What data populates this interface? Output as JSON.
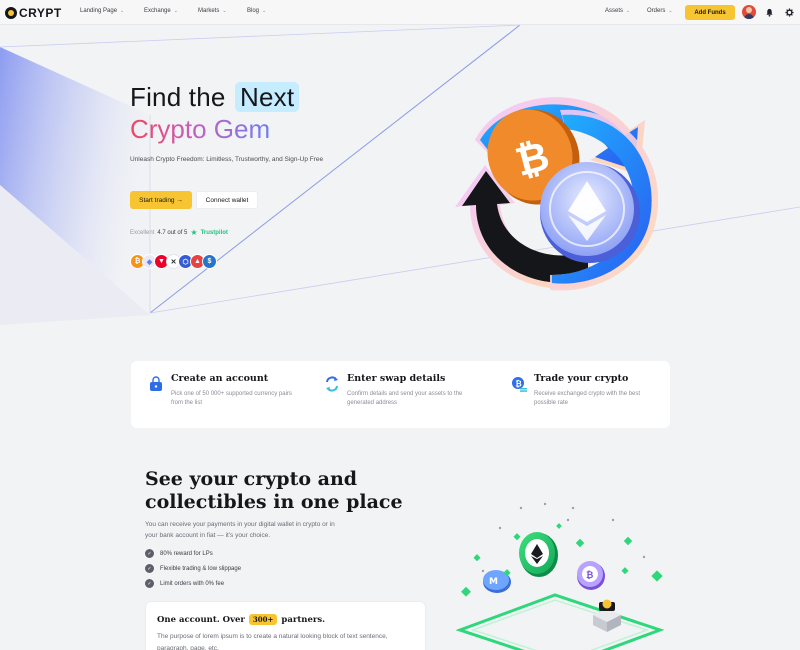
{
  "nav": {
    "logo_text": "CRYPT",
    "items": [
      {
        "label": "Landing Page"
      },
      {
        "label": "Exchange"
      },
      {
        "label": "Markets"
      },
      {
        "label": "Blog"
      }
    ],
    "right_items": [
      {
        "label": "Assets"
      },
      {
        "label": "Orders"
      }
    ],
    "add_funds_label": "Add Funds",
    "icons": [
      "bell-icon",
      "gear-icon"
    ]
  },
  "hero": {
    "title_line1": "Find the",
    "title_highlight": "Next",
    "title_line2": "Crypto Gem",
    "subtitle": "Unleash Crypto Freedom: Limitless, Trustworthy, and Sign-Up Free",
    "start_button": "Start trading →",
    "wallet_button": "Connect wallet",
    "rating_prefix": "Excellent",
    "rating_score": "4.7 out of 5",
    "rating_brand": "Trustpilot",
    "coins": [
      {
        "name": "bitcoin",
        "color": "#f7931a",
        "glyph": "₿"
      },
      {
        "name": "ethereum",
        "color": "#e9e9f5",
        "glyph": "◆"
      },
      {
        "name": "tron",
        "color": "#eb0029",
        "glyph": "▼"
      },
      {
        "name": "xrp",
        "color": "#ffffff",
        "glyph": "✕"
      },
      {
        "name": "chainlink",
        "color": "#375bd2",
        "glyph": "⬡"
      },
      {
        "name": "avalanche",
        "color": "#e84142",
        "glyph": "▲"
      },
      {
        "name": "usdc",
        "color": "#2775ca",
        "glyph": "$"
      }
    ]
  },
  "steps": [
    {
      "title": "Create an account",
      "desc": "Pick one of 50 000+ supported currency pairs from the list",
      "icon": "wallet-icon"
    },
    {
      "title": "Enter swap details",
      "desc": "Confirm details and send your assets to the generated address",
      "icon": "swap-icon"
    },
    {
      "title": "Trade your crypto",
      "desc": "Receive exchanged crypto with the best possible rate",
      "icon": "bitcoin-exchange-icon"
    }
  ],
  "collectibles": {
    "title": "See your crypto and collectibles in one place",
    "desc": "You can receive your payments in your digital wallet in crypto or in your bank account in fiat — it's your choice.",
    "features": [
      "80% reward for LPs",
      "Flexible trading & low slippage",
      "Limit orders with 0% fee"
    ],
    "partner_prefix": "One account. Over",
    "partner_badge": "300+",
    "partner_suffix": "partners.",
    "partner_desc": "The purpose of lorem ipsum is to create a natural looking block of text sentence, paragraph, page, etc."
  },
  "colors": {
    "accent": "#f7c531",
    "background": "#f2f3f5"
  }
}
